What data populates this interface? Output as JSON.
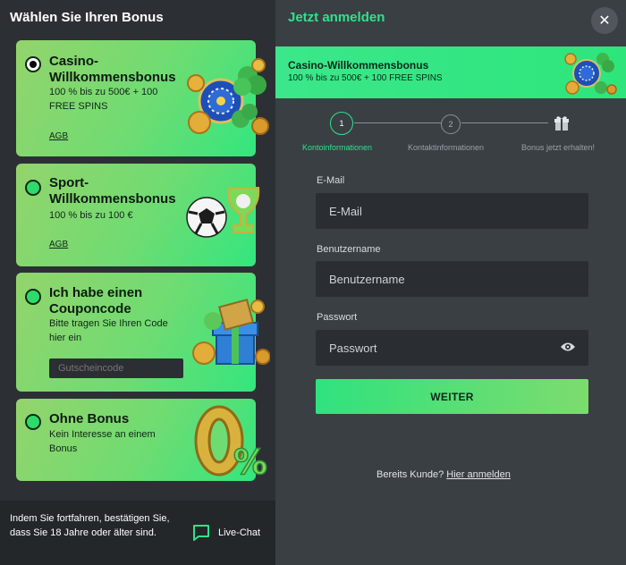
{
  "left": {
    "title": "Wählen Sie Ihren Bonus",
    "cards": [
      {
        "title": "Casino-Willkommensbonus",
        "desc": "100 % bis zu 500€ + 100 FREE SPINS",
        "agb": "AGB",
        "selected": true
      },
      {
        "title": "Sport-Willkommensbonus",
        "desc": "100 % bis zu 100 €",
        "agb": "AGB",
        "selected": false
      },
      {
        "title": "Ich habe einen Couponcode",
        "desc": "Bitte tragen Sie Ihren Code hier ein",
        "placeholder": "Gutscheincode",
        "selected": false
      },
      {
        "title": "Ohne Bonus",
        "desc": "Kein Interesse an einem Bonus",
        "selected": false
      }
    ],
    "footer": {
      "text": "Indem Sie fortfahren, bestätigen Sie, dass Sie 18 Jahre oder älter sind.",
      "chat_label": "Live-Chat"
    }
  },
  "right": {
    "title": "Jetzt anmelden",
    "close_icon": "close-icon",
    "banner": {
      "title": "Casino-Willkommensbonus",
      "subtitle": "100 % bis zu 500€ + 100 FREE SPINS"
    },
    "steps": [
      {
        "number": "1",
        "label": "Kontoinformationen",
        "active": true
      },
      {
        "number": "2",
        "label": "Kontaktinformationen",
        "active": false
      },
      {
        "icon": "gift-icon",
        "label": "Bonus jetzt erhalten!",
        "active": false
      }
    ],
    "form": {
      "email_label": "E-Mail",
      "email_placeholder": "E-Mail",
      "username_label": "Benutzername",
      "username_placeholder": "Benutzername",
      "password_label": "Passwort",
      "password_placeholder": "Passwort",
      "submit_label": "WEITER"
    },
    "login": {
      "prompt": "Bereits Kunde?",
      "link": "Hier anmelden"
    }
  },
  "colors": {
    "accent": "#2de38a",
    "card_green": "#6edc72",
    "panel_dark": "#2c3034",
    "panel_right": "#3a3f44"
  }
}
